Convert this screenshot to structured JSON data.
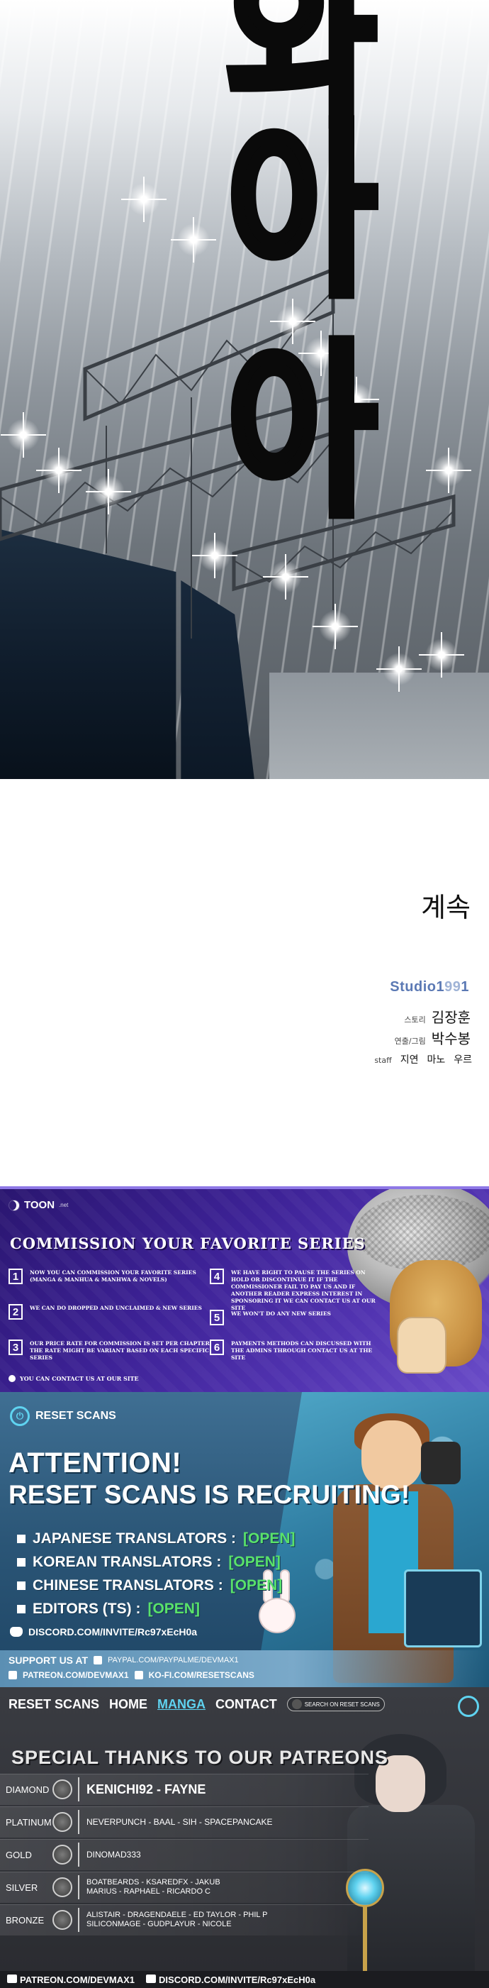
{
  "sfx_text": [
    "와",
    "아",
    "아"
  ],
  "ending": {
    "continued": "계속",
    "studio_logo": {
      "prefix": "Studio1",
      "suffix": "99",
      "tail": "1"
    },
    "credits": [
      {
        "role": "스토리",
        "name": "김장훈"
      },
      {
        "role": "연출/그림",
        "name": "박수봉"
      }
    ],
    "staff": {
      "role": "staff",
      "names": [
        "지연",
        "마노",
        "우르"
      ]
    }
  },
  "commission": {
    "logo_name": "TOON",
    "logo_suffix": ".net",
    "title": "COMMISSION YOUR FAVORITE SERIES",
    "items": [
      {
        "num": "1",
        "text": "NOW YOU CAN COMMISSION YOUR FAVORITE SERIES (MANGA & MANHUA & MANHWA & NOVELS)"
      },
      {
        "num": "2",
        "text": "WE CAN DO DROPPED AND UNCLAIMED & NEW SERIES"
      },
      {
        "num": "3",
        "text": "OUR PRICE RATE FOR COMMISSION IS SET PER CHAPTER THE RATE MIGHT BE VARIANT BASED ON EACH SPECIFIC SERIES"
      },
      {
        "num": "4",
        "text": "WE HAVE RIGHT TO PAUSE THE SERIES ON HOLD OR DISCONTINUE IT IF THE COMMISSIONER FAIL TO PAY US AND IF ANOTHER READER EXPRESS INTEREST IN SPONSORING IT WE CAN CONTACT US AT OUR SITE"
      },
      {
        "num": "5",
        "text": "WE WON'T DO ANY NEW SERIES"
      },
      {
        "num": "6",
        "text": "PAYMENTS METHODS CAN DISCUSSED WITH THE ADMINS THROUGH CONTACT US AT THE SITE"
      }
    ],
    "contact": "YOU CAN CONTACT US AT OUR SITE"
  },
  "recruit": {
    "logo": "RESET SCANS",
    "attention": "ATTENTION!",
    "headline": "RESET SCANS IS RECRUITING!",
    "roles": [
      {
        "label": "JAPANESE TRANSLATORS :",
        "status": "[OPEN]"
      },
      {
        "label": "KOREAN TRANSLATORS :",
        "status": "[OPEN]"
      },
      {
        "label": "CHINESE TRANSLATORS :",
        "status": "[OPEN]"
      },
      {
        "label": "EDITORS  (TS) :",
        "status": "[OPEN]"
      }
    ],
    "discord": "DISCORD.COM/INVITE/Rc97xEcH0a",
    "support_label": "SUPPORT US AT",
    "paypal": "PAYPAL.COM/PAYPALME/DEVMAX1",
    "patreon": "PATREON.COM/DEVMAX1",
    "kofi": "KO-FI.COM/RESETSCANS"
  },
  "patreons": {
    "nav": {
      "brand": "RESET SCANS",
      "home": "HOME",
      "manga": "MANGA",
      "contact": "CONTACT",
      "search_placeholder": "SEARCH ON RESET SCANS"
    },
    "title": "SPECIAL THANKS TO OUR PATREONS",
    "tiers": [
      {
        "tier": "DIAMOND",
        "names": "KENICHI92 - FAYNE",
        "size": "big"
      },
      {
        "tier": "PLATINUM",
        "names": "NEVERPUNCH - BAAL - SIH - SPACEPANCAKE",
        "size": "normal"
      },
      {
        "tier": "GOLD",
        "names": "DINOMAD333",
        "size": "normal"
      },
      {
        "tier": "SILVER",
        "names": "BOATBEARDS - KSAREDFX - JAKUB\nMARIUS - RAPHAEL - RICARDO C",
        "size": "small"
      },
      {
        "tier": "BRONZE",
        "names": "ALISTAIR - DRAGENDAELE - ED TAYLOR - PHIL P\nSILICONMAGE - GUDPLAYUR - NICOLE",
        "size": "small"
      }
    ],
    "footer_patreon": "PATREON.COM/DEVMAX1",
    "footer_discord": "DISCORD.COM/INVITE/Rc97xEcH0a"
  }
}
